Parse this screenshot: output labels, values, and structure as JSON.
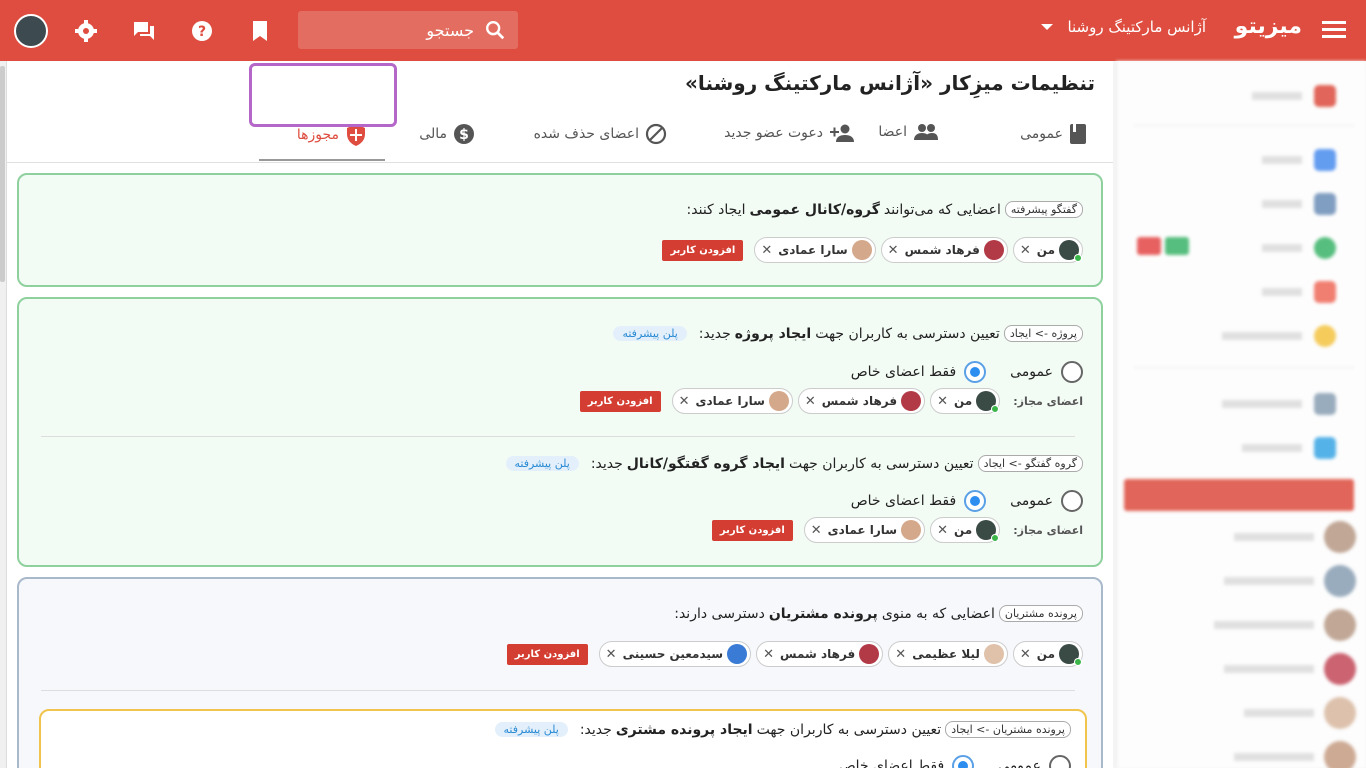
{
  "topbar": {
    "logo": "میزیتو",
    "company": "آژانس مارکتینگ روشنا",
    "search_placeholder": "جستجو"
  },
  "page": {
    "title": "تنظیمات میزِکار «آژانس مارکتینگ روشنا»"
  },
  "tabs": [
    {
      "label": "عمومی",
      "icon": "book-icon"
    },
    {
      "label": "اعضا",
      "icon": "people-icon"
    },
    {
      "label": "دعوت عضو جدید",
      "icon": "add-person-icon"
    },
    {
      "label": "اعضای حذف شده",
      "icon": "block-icon"
    },
    {
      "label": "مالی",
      "icon": "dollar-icon"
    },
    {
      "label": "مجوزها",
      "icon": "shield-icon",
      "active": true
    }
  ],
  "cards": {
    "chat": {
      "tag": "گفتگو پیشرفته",
      "text_pre": "اعضایی که می‌توانند",
      "text_bold": "گروه/کانال عمومی",
      "text_post": "ایجاد کنند:",
      "users": [
        "من",
        "فرهاد شمس",
        "سارا عمادی"
      ],
      "add_label": "افزودن کاربر"
    },
    "project": {
      "tag": "پروژه -> ایجاد",
      "text_pre": "تعیین دسترسی به کاربران جهت",
      "text_bold": "ایجاد پروژه",
      "text_post": "جدید:",
      "plan": "پلن پیشرفته",
      "radio_public": "عمومی",
      "radio_special": "فقط اعضای خاص",
      "allowed_label": "اعضای مجاز:",
      "users": [
        "من",
        "فرهاد شمس",
        "سارا عمادی"
      ],
      "add_label": "افزودن کاربر"
    },
    "group": {
      "tag": "گروه گفتگو -> ایجاد",
      "text_pre": "تعیین دسترسی به کاربران جهت",
      "text_bold": "ایجاد گروه گفتگو/کانال",
      "text_post": "جدید:",
      "plan": "پلن پیشرفته",
      "radio_public": "عمومی",
      "radio_special": "فقط اعضای خاص",
      "allowed_label": "اعضای مجاز:",
      "users": [
        "من",
        "سارا عمادی"
      ],
      "add_label": "افزودن کاربر"
    },
    "customers": {
      "tag": "پرونده مشتریان",
      "text_pre": "اعضایی که به منوی",
      "text_bold": "پرونده مشتریان",
      "text_post": "دسترسی دارند:",
      "users": [
        "من",
        "لیلا عظیمی",
        "فرهاد شمس",
        "سیدمعین حسینی"
      ],
      "add_label": "افزودن کاربر"
    },
    "customer_create": {
      "tag": "پرونده مشتریان -> ایجاد",
      "text_pre": "تعیین دسترسی به کاربران جهت",
      "text_bold": "ایجاد پرونده مشتری",
      "text_post": "جدید:",
      "plan": "پلن پیشرفته",
      "radio_public": "عمومی",
      "radio_special": "فقط اعضای خاص"
    }
  },
  "colors": {
    "brand": "#de4d3f",
    "highlight": "#b466c9",
    "green_border": "#8fd19e",
    "blue_border": "#aab8cc",
    "yellow_border": "#f0c44d"
  }
}
